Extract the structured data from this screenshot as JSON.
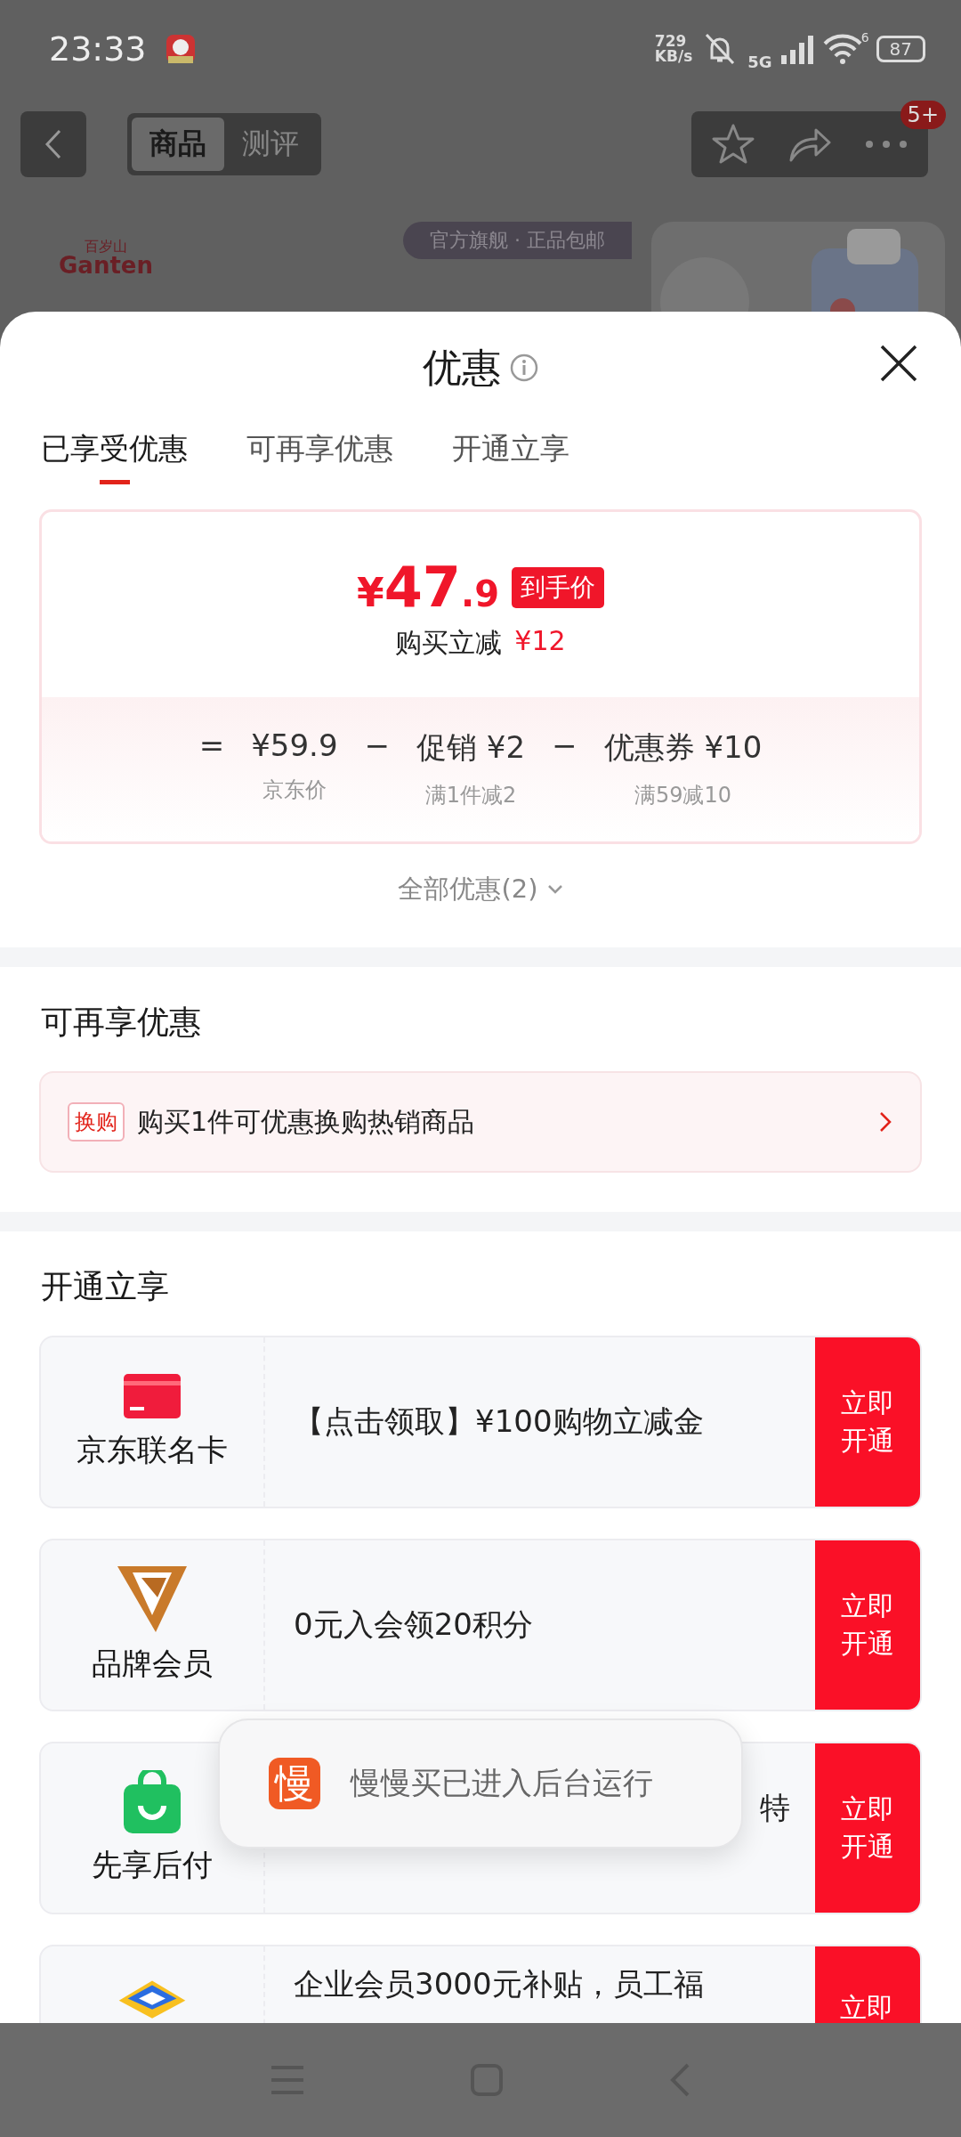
{
  "status_bar": {
    "time": "23:33",
    "net_speed": "729",
    "net_unit": "KB/s",
    "network": "5G",
    "wifi_band": "6",
    "battery": "87"
  },
  "header": {
    "tabs": [
      {
        "label": "商品",
        "selected": true
      },
      {
        "label": "测评",
        "selected": false
      }
    ],
    "message_badge": "5+"
  },
  "product": {
    "brand_cn": "百岁山",
    "brand_latin": "Ganten",
    "tag": "官方旗舰 · 正品包邮"
  },
  "sheet": {
    "title": "优惠",
    "tabs": [
      {
        "label": "已享受优惠",
        "selected": true
      },
      {
        "label": "可再享优惠",
        "selected": false
      },
      {
        "label": "开通立享",
        "selected": false
      }
    ],
    "price": {
      "symbol": "¥",
      "integer": "47",
      "decimal": ".9",
      "label": "到手价",
      "saving_label": "购买立减",
      "saving": "¥12",
      "breakdown": [
        {
          "op": "=",
          "amount": "¥59.9",
          "note": "京东价"
        },
        {
          "op": "−",
          "amount": "促销 ¥2",
          "note": "满1件减2"
        },
        {
          "op": "−",
          "amount": "优惠券 ¥10",
          "note": "满59减10"
        }
      ]
    },
    "all_offers": "全部优惠(2)"
  },
  "more_offers": {
    "title": "可再享优惠",
    "items": [
      {
        "tag": "换购",
        "text": "购买1件可优惠换购热销商品"
      }
    ]
  },
  "open_offers": {
    "title": "开通立享",
    "items": [
      {
        "kind": "card",
        "name": "京东联名卡",
        "desc": "【点击领取】¥100购物立减金",
        "action": "立即开通"
      },
      {
        "kind": "vip",
        "name": "品牌会员",
        "desc": "0元入会领20积分",
        "action": "立即开通"
      },
      {
        "kind": "bag",
        "name": "先享后付",
        "desc": "特",
        "action": "立即开通"
      },
      {
        "kind": "enterprise",
        "desc": "企业会员3000元补贴，员工福",
        "action": "立即"
      }
    ]
  },
  "toast": {
    "icon_char": "慢",
    "text": "慢慢买已进入后台运行"
  }
}
